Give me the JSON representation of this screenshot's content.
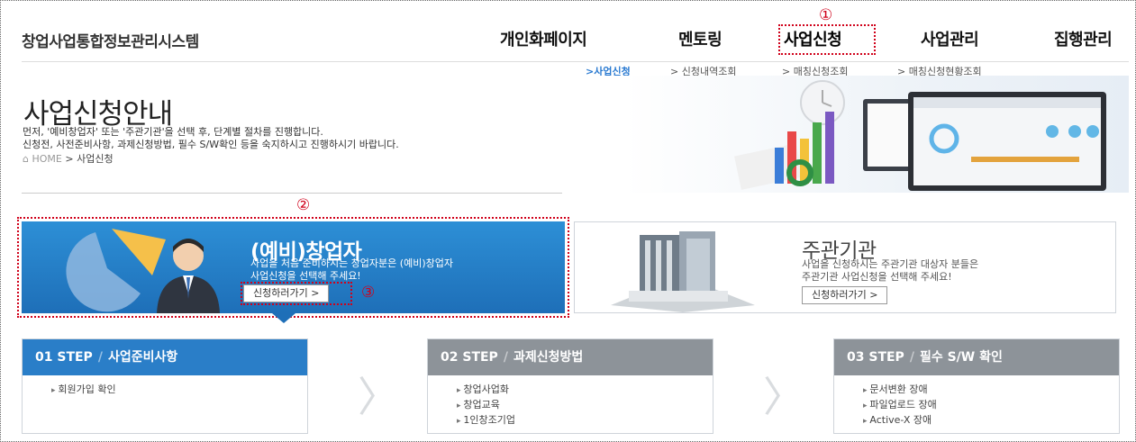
{
  "header": {
    "site_title": "창업사업통합정보관리시스템",
    "nav": [
      "개인화페이지",
      "멘토링",
      "사업신청",
      "사업관리",
      "집행관리"
    ],
    "active_nav": "사업신청",
    "sub_nav": [
      ">사업신청",
      "> 신청내역조회",
      "> 매칭신청조회",
      "> 매칭신청현황조회"
    ]
  },
  "markers": {
    "m1": "①",
    "m2": "②",
    "m3": "③"
  },
  "hero": {
    "title": "사업신청안내",
    "desc_line1": "먼저, '예비창업자' 또는 '주관기관'을 선택 후, 단계별 절차를 진행합니다.",
    "desc_line2": "신청전, 사전준비사항, 과제신청방법, 필수 S/W확인 등을 숙지하시고 진행하시기 바랍니다.",
    "crumb_home": "⌂ HOME",
    "crumb_sep": ">",
    "crumb_current": "사업신청"
  },
  "cards": {
    "founder": {
      "title": "(예비)창업자",
      "desc_line1": "사업을 처음 준비하시는 창업자분은 (예비)창업자",
      "desc_line2": "사업신청을 선택해 주세요!",
      "button": "신청하러가기 >"
    },
    "agency": {
      "title": "주관기관",
      "desc_line1": "사업을 신청하시는 주관기관 대상자 분들은",
      "desc_line2": "주관기관 사업신청을 선택해 주세요!",
      "button": "신청하러가기 >"
    }
  },
  "steps": [
    {
      "num": "01 STEP",
      "sep": "/",
      "title": "사업준비사항",
      "items": [
        "회원가입 확인"
      ]
    },
    {
      "num": "02 STEP",
      "sep": "/",
      "title": "과제신청방법",
      "items": [
        "창업사업화",
        "창업교육",
        "1인창조기업"
      ]
    },
    {
      "num": "03 STEP",
      "sep": "/",
      "title": "필수 S/W 확인",
      "items": [
        "문서변환 장애",
        "파일업로드 장애",
        "Active-X 장애"
      ]
    }
  ],
  "colors": {
    "primary_blue": "#2a7ec8",
    "step_gray": "#8d9399",
    "highlight_red": "#d0021b"
  }
}
